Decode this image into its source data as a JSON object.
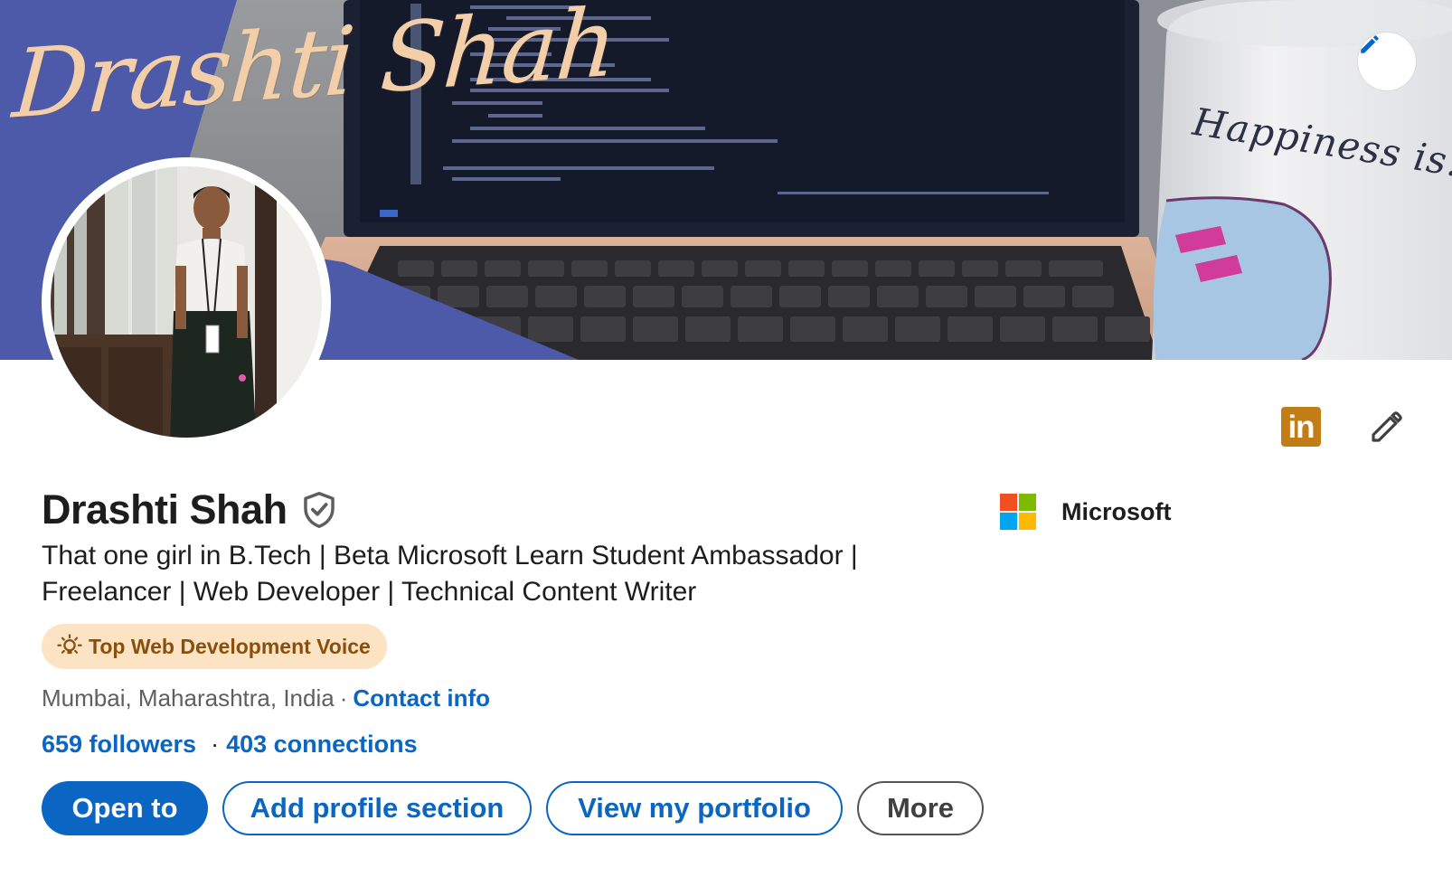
{
  "banner": {
    "title": "Drashti Shah",
    "mug_text": "Happiness is..",
    "edit_icon": "pencil-icon"
  },
  "profile": {
    "name": "Drashti Shah",
    "verified_icon": "verified-shield-icon",
    "headline": "That one girl in B.Tech | Beta Microsoft Learn Student Ambassador | Freelancer | Web Developer | Technical Content Writer",
    "badge": {
      "icon": "lightbulb-icon",
      "label": "Top Web Development Voice"
    },
    "location": "Mumbai, Maharashtra, India",
    "location_separator": "·",
    "contact_info": "Contact info",
    "followers": "659 followers",
    "network_separator": "·",
    "connections": "403 connections"
  },
  "company": {
    "name": "Microsoft",
    "logo_colors": [
      "#f25022",
      "#7fba00",
      "#00a4ef",
      "#ffb900"
    ]
  },
  "actions": {
    "linkedin_badge": "in",
    "edit_icon": "pencil-icon",
    "open_to": "Open to",
    "add_section": "Add profile section",
    "portfolio": "View my portfolio",
    "more": "More"
  },
  "colors": {
    "brand_blue": "#0a66c2",
    "banner_blue": "#4c5aa9",
    "badge_bg": "#fbe3c4",
    "badge_text": "#8a4f0c",
    "linkedin_gold": "#c37d16"
  }
}
